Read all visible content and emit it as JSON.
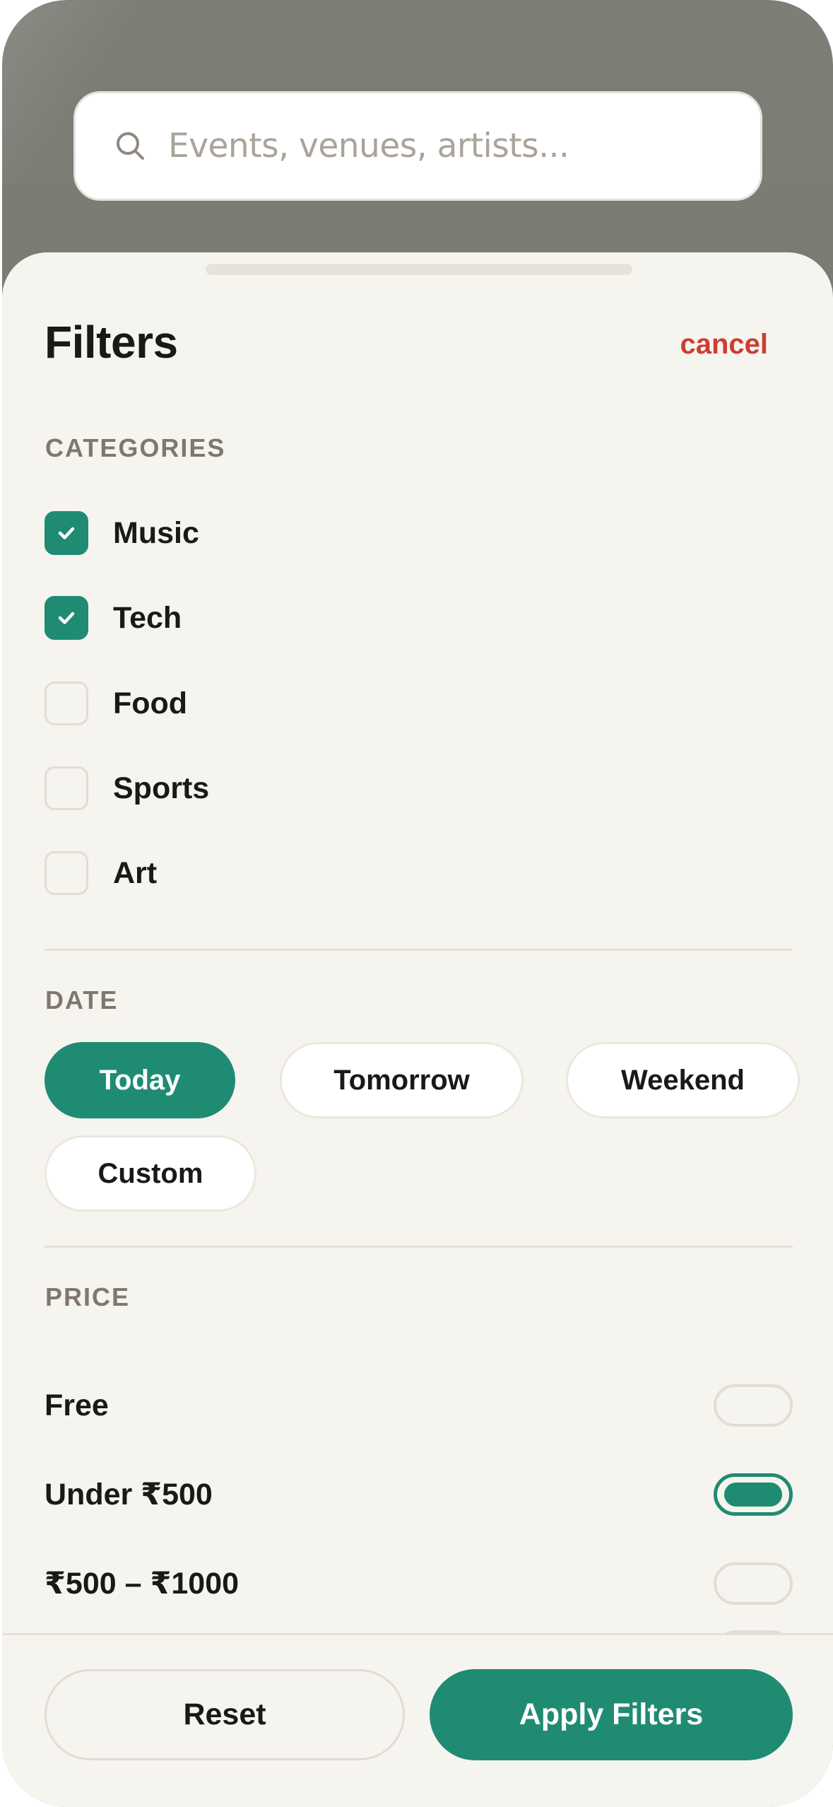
{
  "search": {
    "placeholder": "Events, venues, artists..."
  },
  "sheet": {
    "title": "Filters",
    "cancel_label": "cancel",
    "categories": {
      "label": "CATEGORIES",
      "items": [
        {
          "label": "Music",
          "checked": true
        },
        {
          "label": "Tech",
          "checked": true
        },
        {
          "label": "Food",
          "checked": false
        },
        {
          "label": "Sports",
          "checked": false
        },
        {
          "label": "Art",
          "checked": false
        }
      ]
    },
    "date": {
      "label": "DATE",
      "options": [
        "Today",
        "Tomorrow",
        "Weekend",
        "Custom"
      ],
      "selected": "Today"
    },
    "price": {
      "label": "PRICE",
      "options": [
        {
          "label": "Free",
          "on": false
        },
        {
          "label": "Under ₹500",
          "on": true
        },
        {
          "label": "₹500 – ₹1000",
          "on": false
        }
      ]
    },
    "footer": {
      "reset_label": "Reset",
      "apply_label": "Apply Filters"
    }
  },
  "colors": {
    "accent": "#1f8b73",
    "danger": "#cc3e31",
    "sheet_bg": "#f6f4ef",
    "backdrop": "#75786f"
  },
  "icons": {
    "search": "search-icon",
    "check": "check-icon"
  }
}
